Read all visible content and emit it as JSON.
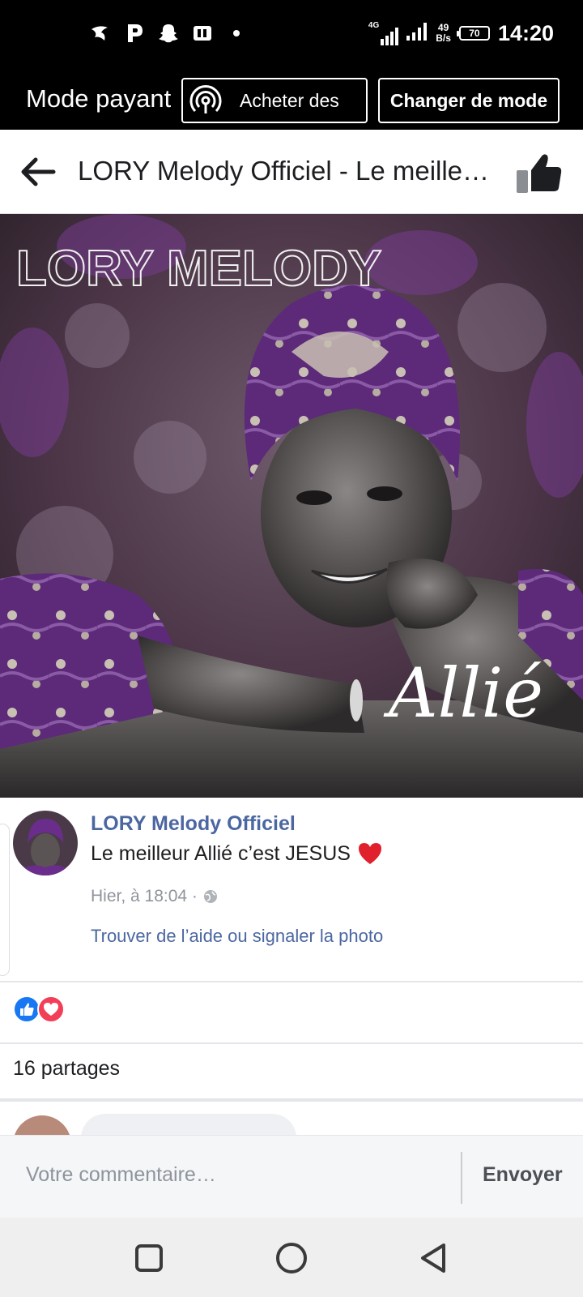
{
  "status_bar": {
    "time": "14:20",
    "network": "4G",
    "speed_value": "49",
    "speed_unit": "B/s",
    "battery": "70",
    "notification_icons": [
      "vpn-bird-icon",
      "parking-p-icon",
      "snapchat-ghost-icon",
      "flash-app-icon",
      "dot-icon"
    ]
  },
  "mode_bar": {
    "label": "Mode payant",
    "buy_button": "Acheter des",
    "change_mode_button": "Changer de mode"
  },
  "header": {
    "title": "LORY Melody Officiel - Le meilleur Allié c’est JESUS",
    "back_icon": "arrow-left-icon",
    "like_icon": "thumbs-up-icon"
  },
  "photo": {
    "overlay_brand": "LORY MELODY",
    "overlay_signature": "Allié"
  },
  "post": {
    "author": "LORY Melody Officiel",
    "caption": "Le meilleur Allié c’est JESUS",
    "caption_emoji": "red-heart-icon",
    "timestamp": "Hier, à 18:04 ·",
    "privacy_icon": "globe-icon",
    "report_link": "Trouver de l’aide ou signaler la photo"
  },
  "reactions": [
    "like",
    "love"
  ],
  "shares": "16 partages",
  "comment_bar": {
    "placeholder": "Votre commentaire…",
    "send": "Envoyer"
  },
  "colors": {
    "link": "#4b67a1",
    "like": "#1877f2",
    "love": "#f33e58",
    "photo_accent": "#6b2d8b"
  }
}
